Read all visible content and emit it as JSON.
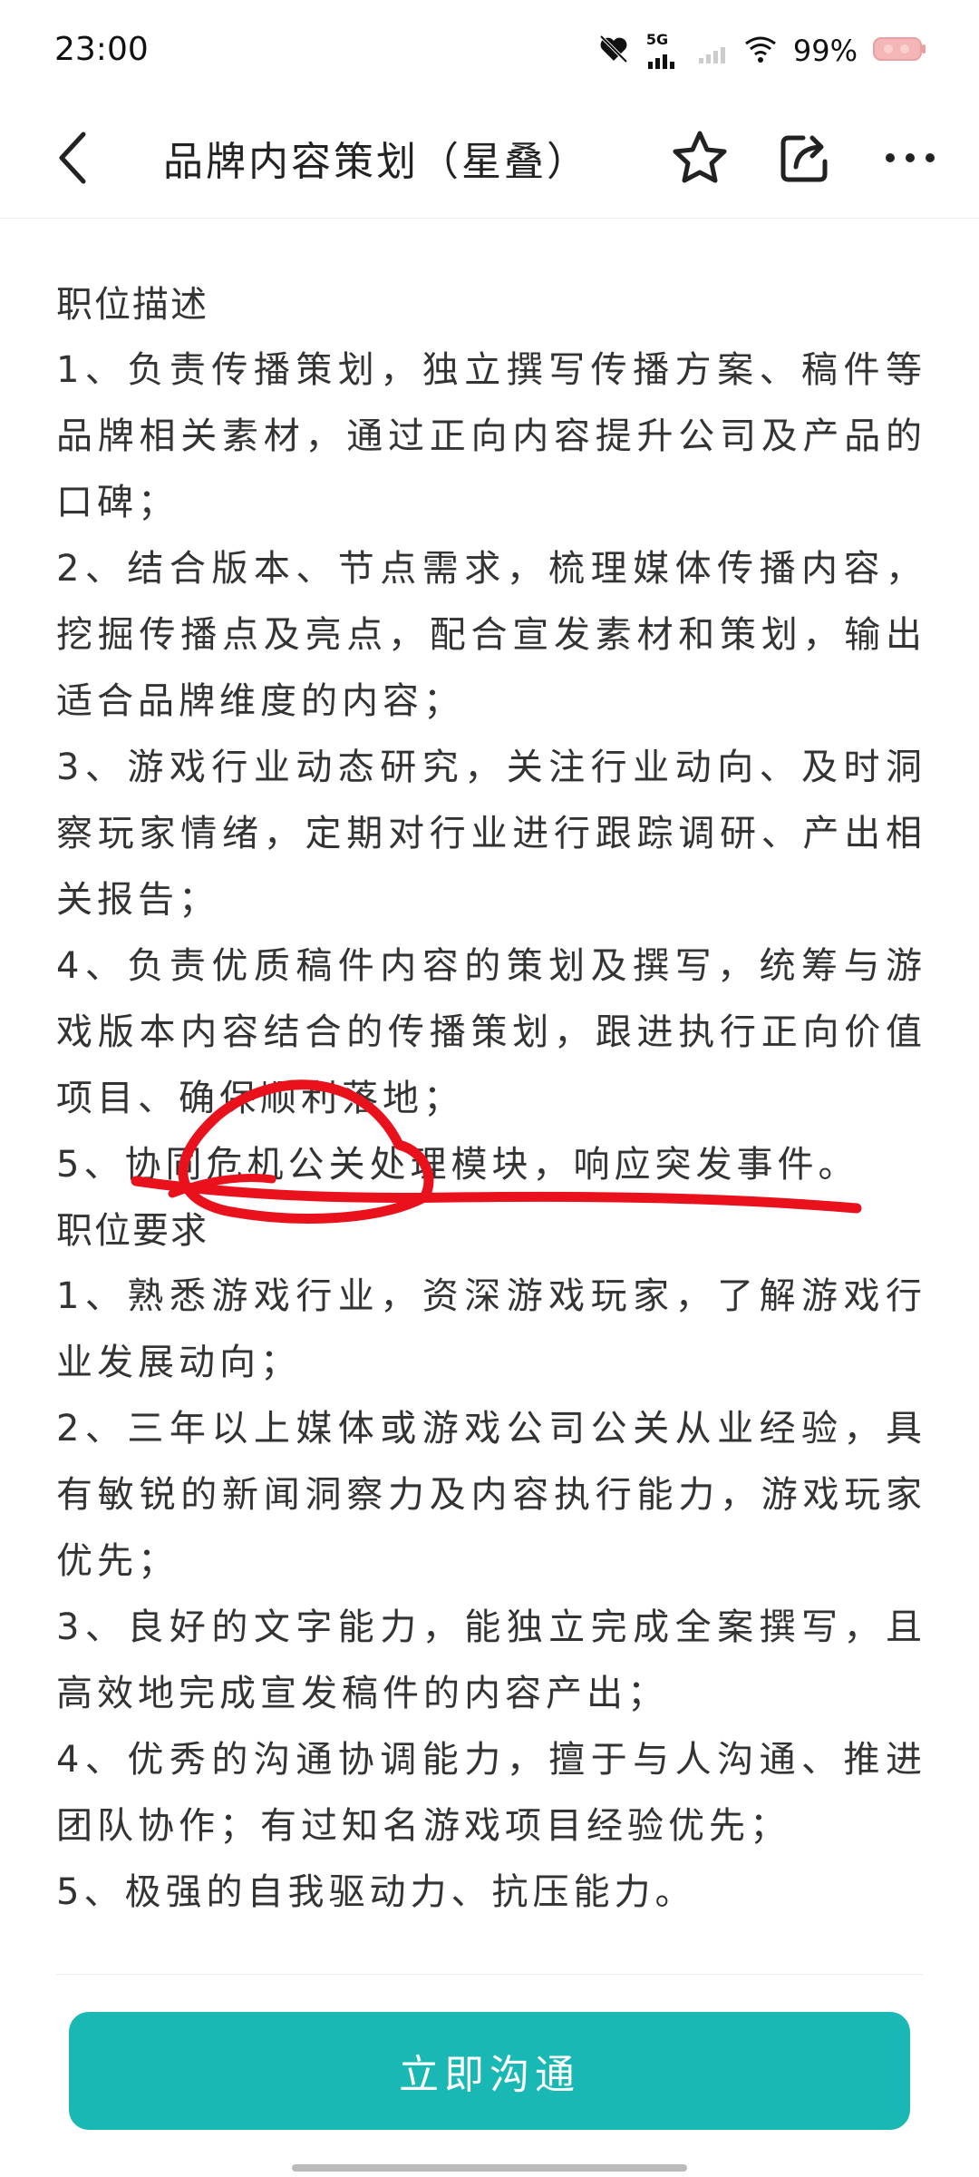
{
  "status_bar": {
    "time": "23:00",
    "network": "5G",
    "battery_percent": "99%"
  },
  "header": {
    "title": "品牌内容策划（星叠）"
  },
  "job_description": {
    "heading": "职位描述",
    "items": [
      "1、负责传播策划，独立撰写传播方案、稿件等品牌相关素材，通过正向内容提升公司及产品的口碑；",
      "2、结合版本、节点需求，梳理媒体传播内容，挖掘传播点及亮点，配合宣发素材和策划，输出适合品牌维度的内容；",
      "3、游戏行业动态研究，关注行业动向、及时洞察玩家情绪，定期对行业进行跟踪调研、产出相关报告；",
      "4、负责优质稿件内容的策划及撰写，统筹与游戏版本内容结合的传播策划，跟进执行正向价值项目、确保顺利落地；",
      "5、协同危机公关处理模块，响应突发事件。"
    ]
  },
  "job_requirements": {
    "heading": "职位要求",
    "items": [
      "1、熟悉游戏行业，资深游戏玩家，了解游戏行业发展动向；",
      "2、三年以上媒体或游戏公司公关从业经验，具有敏锐的新闻洞察力及内容执行能力，游戏玩家优先；",
      "3、良好的文字能力，能独立完成全案撰写，且高效地完成宣发稿件的内容产出；",
      "4、优秀的沟通协调能力，擅于与人沟通、推进团队协作；有过知名游戏项目经验优先；",
      "5、极强的自我驱动力、抗压能力。"
    ]
  },
  "footer": {
    "cta_label": "立即沟通"
  },
  "colors": {
    "accent": "#1ab8b5",
    "annotation": "#e8111c"
  },
  "icons": {
    "back": "chevron-left-icon",
    "favorite": "star-icon",
    "share": "share-icon",
    "more": "more-dots-icon"
  }
}
